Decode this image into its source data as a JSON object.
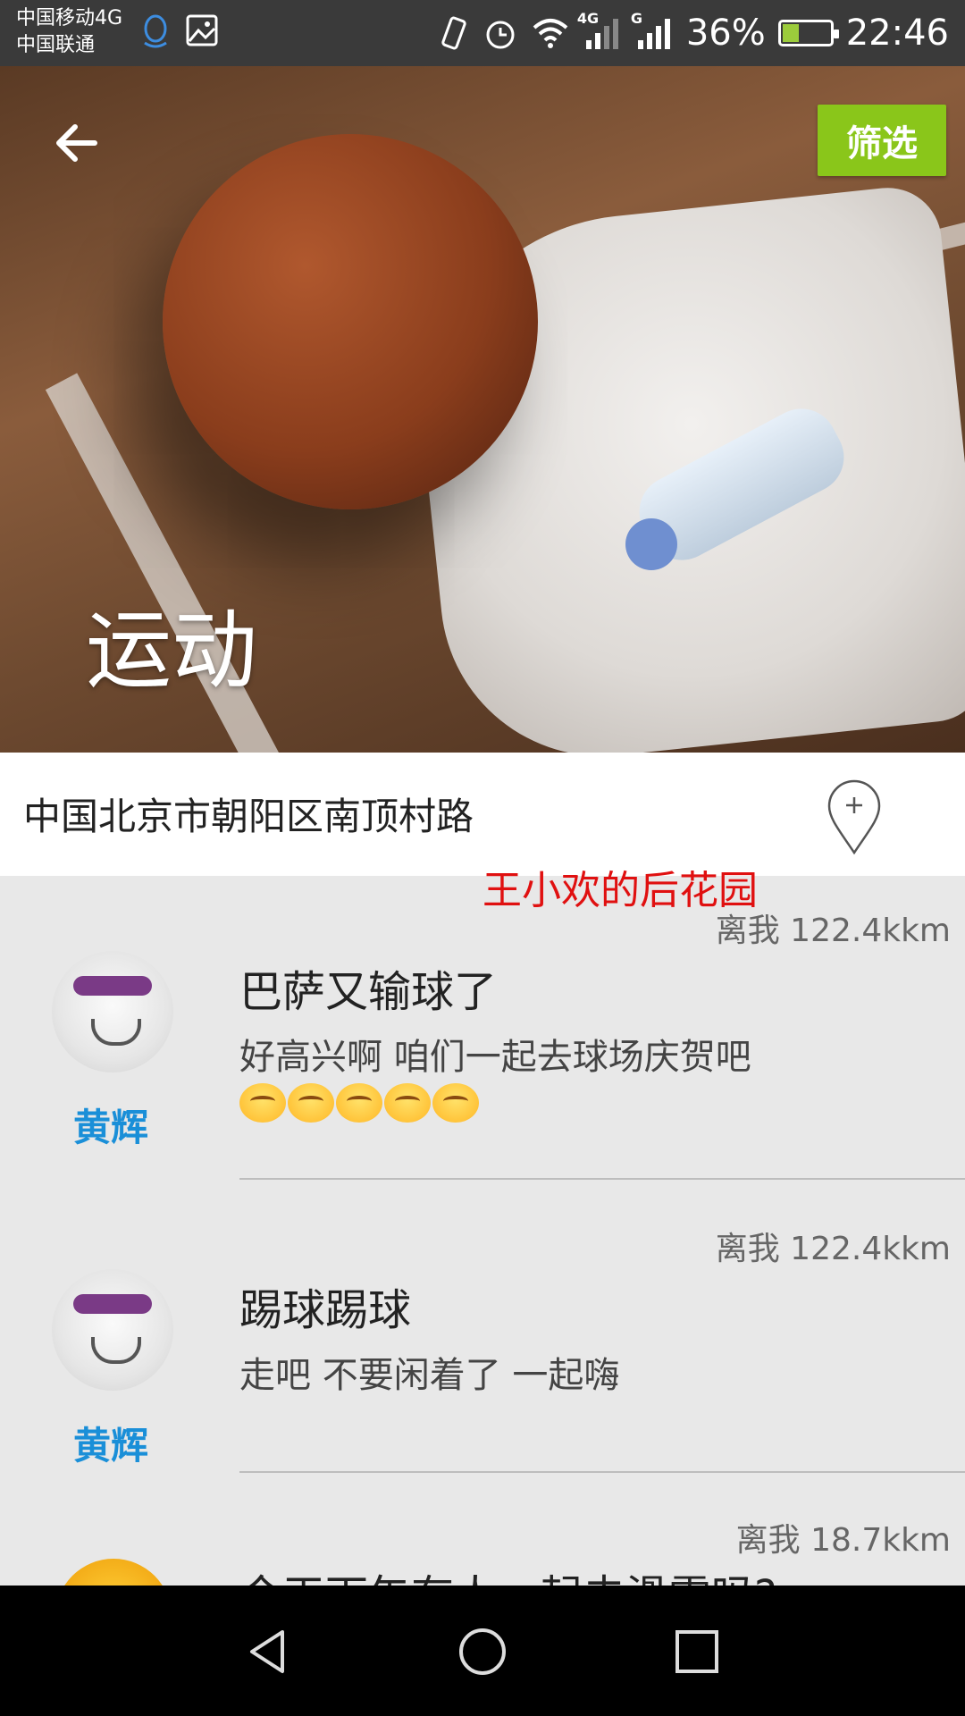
{
  "status_bar": {
    "carrier_1": "中国移动4G",
    "carrier_2": "中国联通",
    "signal_1_label": "4G",
    "signal_2_label": "G",
    "battery_percent": "36%",
    "battery_level": 0.36,
    "time": "22:46",
    "icons": [
      "qq-icon",
      "image-icon",
      "vibrate-icon",
      "alarm-icon",
      "wifi-icon",
      "signal-icon",
      "signal-icon",
      "battery-icon"
    ]
  },
  "hero": {
    "title": "运动",
    "filter_label": "筛选",
    "back_icon": "arrow-left-icon"
  },
  "location": {
    "address": "中国北京市朝阳区南顶村路",
    "add_icon": "add-location-pin-icon"
  },
  "watermark": "王小欢的后花园",
  "feed": [
    {
      "distance": "离我 122.4kkm",
      "user": "黄辉",
      "title": "巴萨又输球了",
      "text": "好高兴啊  咱们一起去球场庆贺吧",
      "emoji_count": 5
    },
    {
      "distance": "离我 122.4kkm",
      "user": "黄辉",
      "title": "踢球踢球",
      "text": "走吧   不要闲着了  一起嗨",
      "emoji_count": 0
    },
    {
      "distance": "离我 18.7kkm",
      "title": "今天下午有人一起去滑雪吗?"
    }
  ],
  "nav": {
    "back_icon": "nav-back-icon",
    "home_icon": "nav-home-icon",
    "recents_icon": "nav-recents-icon"
  },
  "colors": {
    "accent_green": "#8ac61a",
    "username_blue": "#1a8fd8",
    "watermark_red": "#e01010"
  }
}
